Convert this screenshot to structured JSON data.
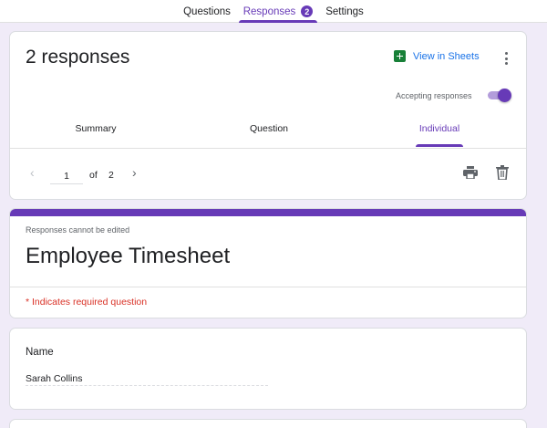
{
  "top_tabs": {
    "questions": "Questions",
    "responses": "Responses",
    "responses_count": "2",
    "settings": "Settings"
  },
  "summary": {
    "response_count_title": "2 responses",
    "view_in_sheets": "View in Sheets",
    "accepting_label": "Accepting responses",
    "accepting_on": true,
    "tabs": [
      "Summary",
      "Question",
      "Individual"
    ],
    "active_tab": "Individual",
    "pager": {
      "current": "1",
      "of_label": "of",
      "total": "2"
    }
  },
  "form": {
    "notice": "Responses cannot be edited",
    "title": "Employee Timesheet",
    "required_note": "* Indicates required question"
  },
  "question": {
    "label": "Name",
    "answer": "Sarah Collins"
  },
  "colors": {
    "accent": "#673ab7",
    "background": "#f0ebf8",
    "link": "#1a73e8",
    "required": "#d93025",
    "sheets_green": "#188038"
  },
  "icons": {
    "sheets": "sheets-icon",
    "more": "more-vert-icon",
    "prev": "chevron-left-icon",
    "next": "chevron-right-icon",
    "print": "print-icon",
    "delete": "trash-icon"
  }
}
